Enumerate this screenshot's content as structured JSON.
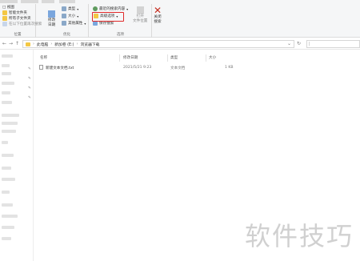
{
  "ribbon": {
    "group1": {
      "item1": "□ 视图",
      "item2": "智能文件夹",
      "item3": "所有子文件夹",
      "item4": "在以下位置再次搜索",
      "label": "位置"
    },
    "group2": {
      "big_button": "修改\n日期",
      "item1": "类型",
      "item2": "大小",
      "item3": "其他属性",
      "label": "优化"
    },
    "group3": {
      "item1": "最近的搜索内容",
      "item2": "高级选项",
      "item3": "保存搜索",
      "big_button": "打开\n文件位置",
      "label": "选项"
    },
    "close_button": "关闭\n搜索"
  },
  "address": {
    "crumbs": [
      "此电脑",
      "新加卷 (E:)",
      "浏览器下载"
    ]
  },
  "file_list": {
    "headers": [
      "名称",
      "修改日期",
      "类型",
      "大小"
    ],
    "rows": [
      {
        "name": "新建文本文档.txt",
        "date": "2021/5/21 9:23",
        "type": "文本文档",
        "size": "1 KB"
      }
    ]
  },
  "watermark": "软件技巧",
  "colors": {
    "highlight": "#e02a2a",
    "folder": "#f3c744",
    "close_x": "#c42b1c"
  }
}
